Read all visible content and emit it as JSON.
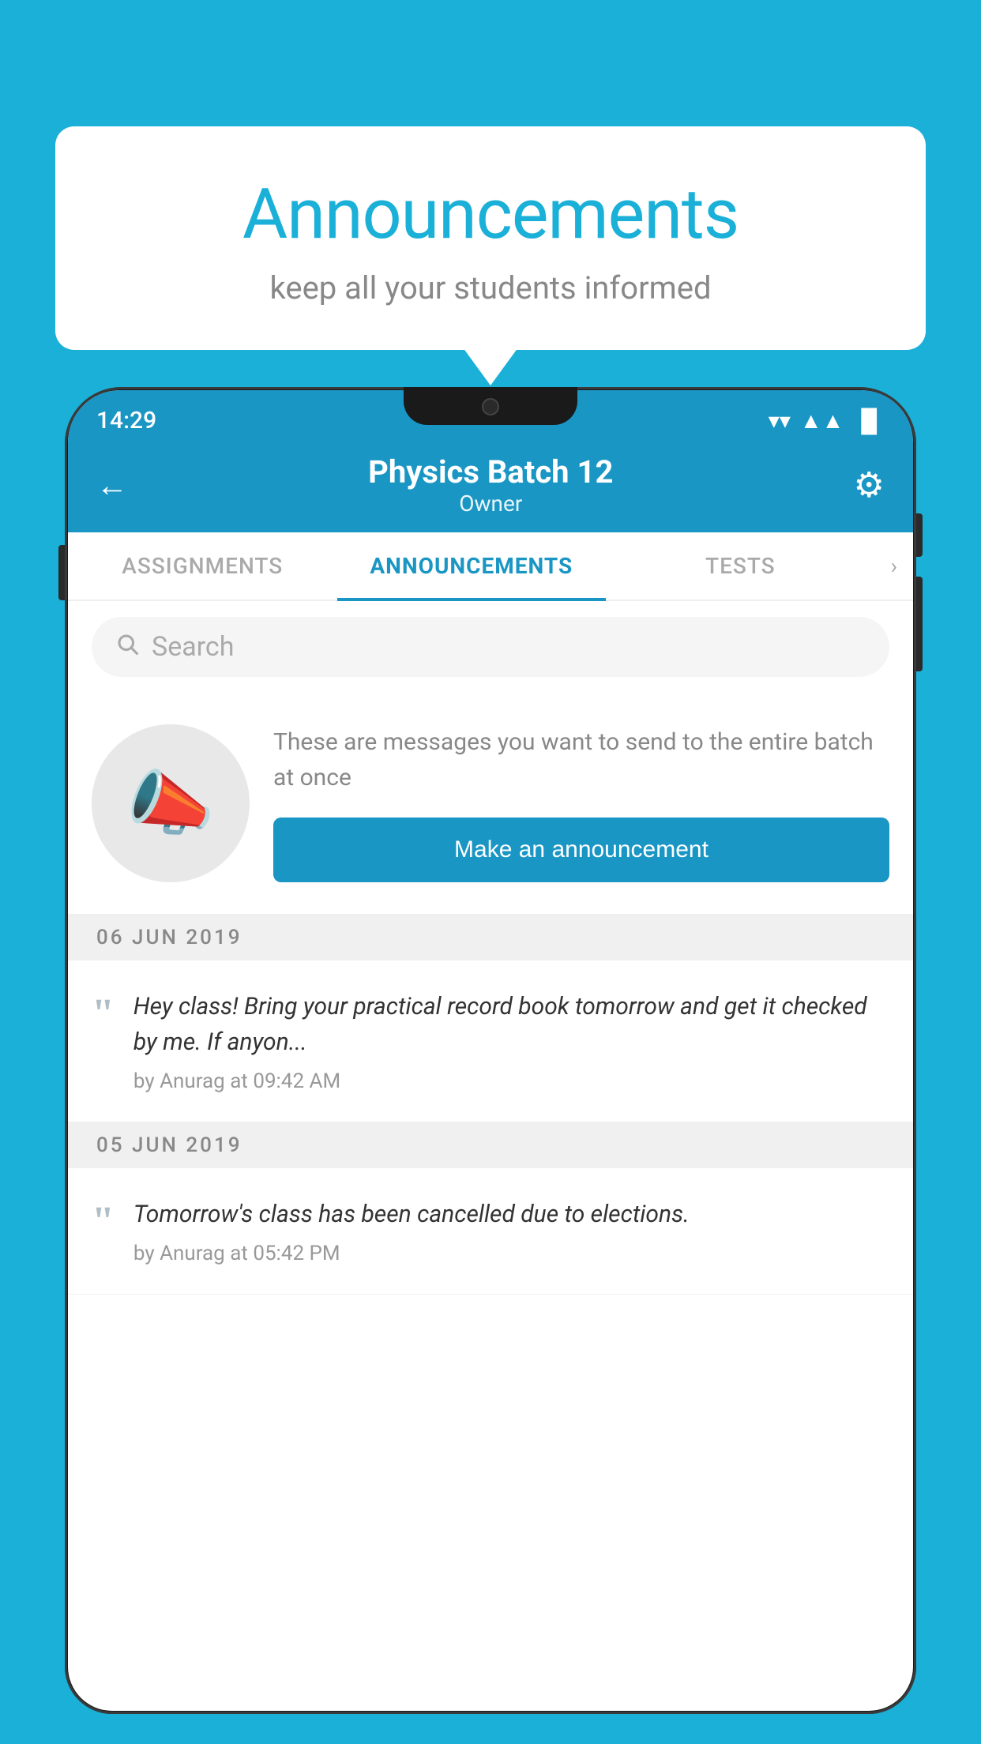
{
  "background_color": "#1ab0d8",
  "speech_bubble": {
    "title": "Announcements",
    "subtitle": "keep all your students informed"
  },
  "status_bar": {
    "time": "14:29",
    "wifi": "▲",
    "signal": "▲",
    "battery": "▐"
  },
  "header": {
    "title": "Physics Batch 12",
    "subtitle": "Owner",
    "back_label": "←",
    "gear_label": "⚙"
  },
  "tabs": [
    {
      "label": "ASSIGNMENTS",
      "active": false
    },
    {
      "label": "ANNOUNCEMENTS",
      "active": true
    },
    {
      "label": "TESTS",
      "active": false
    }
  ],
  "search": {
    "placeholder": "Search"
  },
  "announcement_cta": {
    "description": "These are messages you want to send to the entire batch at once",
    "button_label": "Make an announcement"
  },
  "date_groups": [
    {
      "date": "06  JUN  2019",
      "announcements": [
        {
          "text": "Hey class! Bring your practical record book tomorrow and get it checked by me. If anyon...",
          "meta": "by Anurag at 09:42 AM"
        }
      ]
    },
    {
      "date": "05  JUN  2019",
      "announcements": [
        {
          "text": "Tomorrow's class has been cancelled due to elections.",
          "meta": "by Anurag at 05:42 PM"
        }
      ]
    }
  ]
}
